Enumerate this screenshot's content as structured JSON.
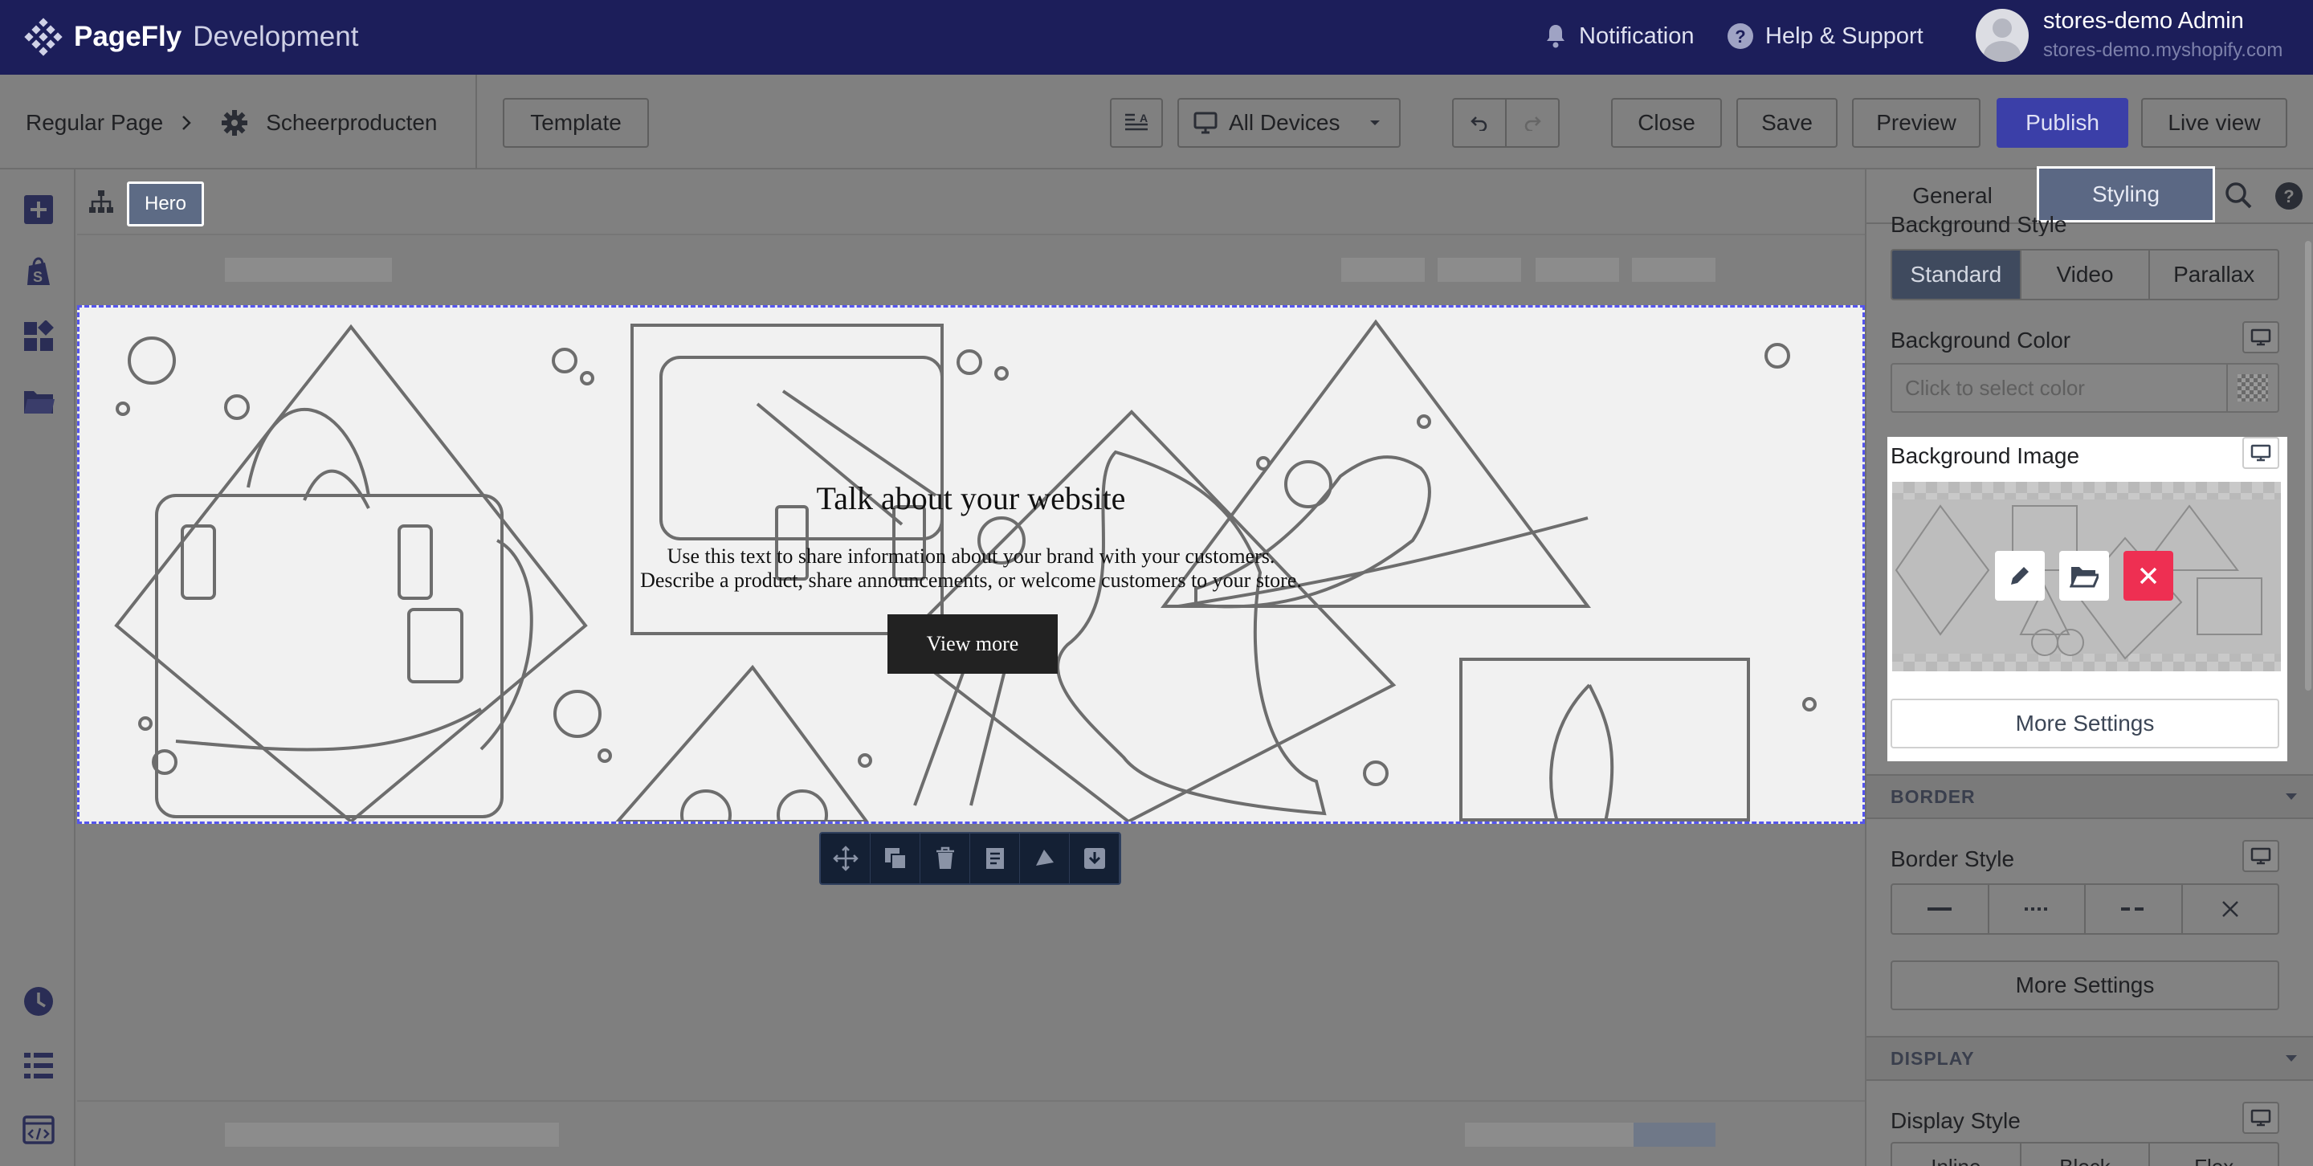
{
  "header": {
    "brand_name": "PageFly",
    "brand_env": "Development",
    "notification_label": "Notification",
    "help_label": "Help & Support",
    "user_name": "stores-demo Admin",
    "user_store": "stores-demo.myshopify.com"
  },
  "toolbar": {
    "page_type": "Regular Page",
    "page_name": "Scheerproducten",
    "template_label": "Template",
    "devices_label": "All Devices",
    "close_label": "Close",
    "save_label": "Save",
    "preview_label": "Preview",
    "publish_label": "Publish",
    "live_view_label": "Live view"
  },
  "layer": {
    "selected_element": "Hero"
  },
  "hero": {
    "title": "Talk about your website",
    "desc_line1": "Use this text to share information about your brand with your customers.",
    "desc_line2": "Describe a product, share announcements, or welcome customers to your store.",
    "button_label": "View more"
  },
  "panel": {
    "tabs": [
      "General",
      "Styling"
    ],
    "active_tab": "Styling",
    "background_style_label": "Background Style",
    "background_style_options": [
      "Standard",
      "Video",
      "Parallax"
    ],
    "background_style_selected": "Standard",
    "background_color_label": "Background Color",
    "background_color_placeholder": "Click to select color",
    "background_image_label": "Background Image",
    "more_settings_label": "More Settings",
    "border_section": "BORDER",
    "border_style_label": "Border Style",
    "display_section": "DISPLAY",
    "display_style_label": "Display Style",
    "display_style_options": [
      "Inline",
      "Block",
      "Flex"
    ]
  },
  "colors": {
    "header_bg": "#1c1e5a",
    "publish_bg": "#3b3fa8",
    "remove_red": "#ee2f52",
    "selection_outline": "#5555ee"
  }
}
